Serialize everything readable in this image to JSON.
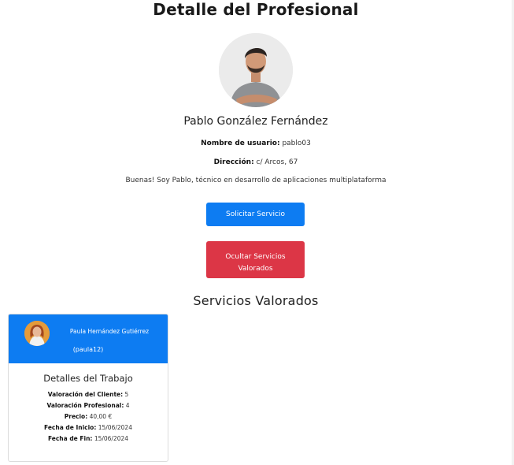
{
  "page": {
    "title": "Detalle del Profesional"
  },
  "profile": {
    "name": "Pablo González Fernández",
    "username_label": "Nombre de usuario:",
    "username": "pablo03",
    "address_label": "Dirección:",
    "address": "c/ Arcos, 67",
    "bio": "Buenas! Soy Pablo, técnico en desarrollo de aplicaciones multiplataforma"
  },
  "actions": {
    "request_label": "Solicitar Servicio",
    "hide_label_line1": "Ocultar Servicios",
    "hide_label_line2": "Valorados"
  },
  "rated_services": {
    "title": "Servicios Valorados",
    "items": [
      {
        "client_name": "Paula Hernández Gutiérrez",
        "client_handle": "(paula12)",
        "details_title": "Detalles del Trabajo",
        "client_rating_label": "Valoración del Cliente:",
        "client_rating": "5",
        "pro_rating_label": "Valoración Profesional:",
        "pro_rating": "4",
        "price_label": "Precio:",
        "price": "40,00 €",
        "start_label": "Fecha de Inicio:",
        "start_date": "15/06/2024",
        "end_label": "Fecha de Fin:",
        "end_date": "15/06/2024"
      }
    ]
  },
  "colors": {
    "primary": "#0d7cf2",
    "danger": "#dc3646"
  }
}
